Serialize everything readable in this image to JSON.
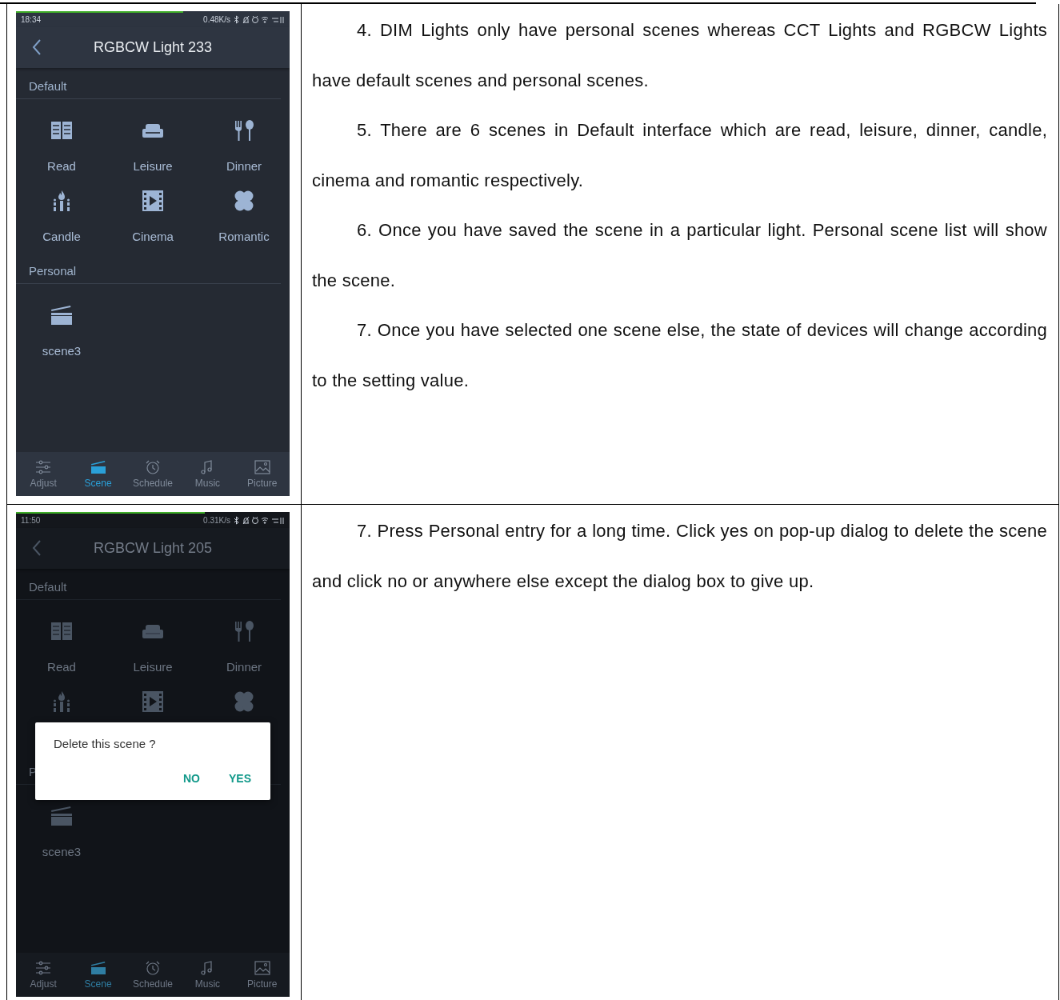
{
  "rows": [
    {
      "screen": {
        "status": {
          "time": "18:34",
          "speed": "0.48K/s",
          "progress": {
            "level": 0.61
          }
        },
        "title": "RGBCW Light 233",
        "sections": [
          {
            "title": "Default",
            "items": [
              {
                "label": "Read",
                "kind": "book"
              },
              {
                "label": "Leisure",
                "kind": "sofa"
              },
              {
                "label": "Dinner",
                "kind": "cutlery"
              },
              {
                "label": "Candle",
                "kind": "candles"
              },
              {
                "label": "Cinema",
                "kind": "film"
              },
              {
                "label": "Romantic",
                "kind": "clover"
              }
            ]
          },
          {
            "title": "Personal",
            "items": [
              {
                "label": "scene3",
                "kind": "clapper"
              }
            ]
          }
        ],
        "tabs": [
          {
            "label": "Adjust",
            "kind": "sliders",
            "selected": false
          },
          {
            "label": "Scene",
            "kind": "clapper",
            "selected": true
          },
          {
            "label": "Schedule",
            "kind": "clock",
            "selected": false
          },
          {
            "label": "Music",
            "kind": "note",
            "selected": false
          },
          {
            "label": "Picture",
            "kind": "image",
            "selected": false
          }
        ]
      },
      "paragraphs": [
        "4. DIM Lights only have personal scenes whereas CCT Lights and RGBCW Lights have default scenes and personal scenes.",
        "5. There are 6 scenes in Default interface which are read, leisure, dinner, candle, cinema and romantic respectively.",
        "6. Once you have saved the scene in a particular light. Personal scene list will show the scene.",
        "7. Once you have selected one scene else, the state of devices will change according to the setting value."
      ]
    },
    {
      "screen": {
        "status": {
          "time": "11:50",
          "speed": "0.31K/s",
          "progress": {
            "level": 0.69
          }
        },
        "title": "RGBCW Light 205",
        "sections": [
          {
            "title": "Default",
            "items": [
              {
                "label": "Read",
                "kind": "book"
              },
              {
                "label": "Leisure",
                "kind": "sofa"
              },
              {
                "label": "Dinner",
                "kind": "cutlery"
              },
              {
                "kind": "candles"
              },
              {
                "kind": "film"
              },
              {
                "kind": "clover"
              }
            ]
          },
          {
            "title": "P",
            "items": [
              {
                "label": "scene3",
                "kind": "clapper"
              }
            ]
          }
        ],
        "tabs": [
          {
            "label": "Adjust",
            "kind": "sliders",
            "selected": false
          },
          {
            "label": "Scene",
            "kind": "clapper",
            "selected": true
          },
          {
            "label": "Schedule",
            "kind": "clock",
            "selected": false
          },
          {
            "label": "Music",
            "kind": "note",
            "selected": false
          },
          {
            "label": "Picture",
            "kind": "image",
            "selected": false
          }
        ],
        "dialog": {
          "message": "Delete this scene ?",
          "buttons": [
            "NO",
            "YES"
          ]
        }
      },
      "paragraphs": [
        "7. Press Personal entry for a long time. Click yes on pop-up dialog to delete the scene and click no or anywhere else except the dialog box to give up."
      ]
    }
  ]
}
